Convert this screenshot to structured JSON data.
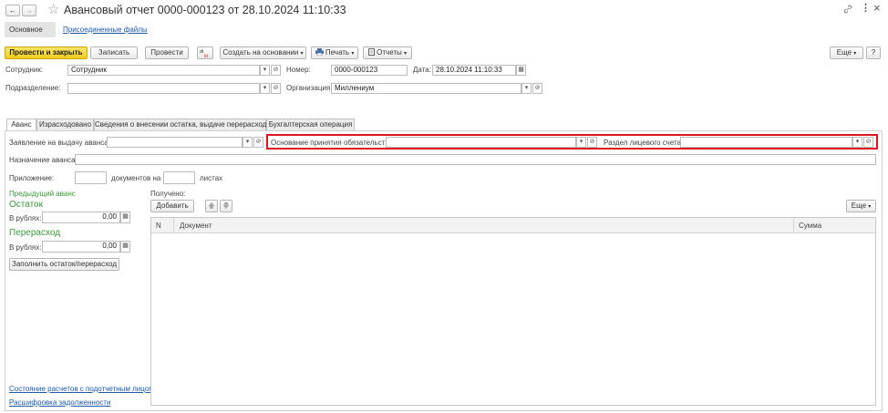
{
  "window": {
    "title": "Авансовый отчет 0000-000123 от 28.10.2024 11:10:33",
    "nav_back": "←",
    "nav_forward": "→",
    "star": "☆",
    "link_icon": "link-icon",
    "more_dots": "⋮",
    "close": "×"
  },
  "sections": {
    "main": "Основное",
    "attached_files": "Присоединенные файлы"
  },
  "toolbar": {
    "post_and_close": "Провести и закрыть",
    "save": "Записать",
    "post": "Провести",
    "create_based": "Создать на основании",
    "print": "Печать",
    "reports": "Отчеты",
    "more": "Еще",
    "help": "?"
  },
  "header": {
    "employee_label": "Сотрудник:",
    "employee_value": "Сотрудник",
    "number_label": "Номер:",
    "number_value": "0000-000123",
    "date_label": "Дата:",
    "date_value": "28.10.2024 11:10:33",
    "department_label": "Подразделение:",
    "department_value": "",
    "organization_label": "Организация:",
    "organization_value": "Миллениум"
  },
  "tabs": [
    {
      "label": "Аванс"
    },
    {
      "label": "Израсходовано"
    },
    {
      "label": "Сведения о внесении остатка, выдаче перерасхода"
    },
    {
      "label": "Бухгалтерская операция"
    }
  ],
  "advance": {
    "request_label": "Заявление на выдачу аванса:",
    "request_value": "",
    "basis_label": "Основание принятия обязательства:",
    "basis_value": "",
    "account_section_label": "Раздел лицевого счета:",
    "account_section_value": "",
    "purpose_label": "Назначение аванса:",
    "purpose_value": "",
    "attachment_label": "Приложение:",
    "documents_on_label": "документов на",
    "sheets_label": "листах",
    "previous_advance": "Предыдущий аванс",
    "remainder_title": "Остаток",
    "in_rubles_label": "В рублях:",
    "remainder_value": "0,00",
    "overspend_title": "Перерасход",
    "overspend_value": "0,00",
    "fill_button": "Заполнить остаток/перерасход",
    "link_settlements": "Состояние расчетов с подотчетным лицом",
    "link_debt": "Расшифровка задолженности"
  },
  "received": {
    "label": "Получено:",
    "add_button": "Добавить",
    "more": "Еще",
    "columns": [
      "N",
      "Документ",
      "Сумма"
    ],
    "rows": []
  },
  "colors": {
    "accent_yellow": "#f5d21f",
    "highlight_red": "#e0141e",
    "green_text": "#3a9a3a",
    "link_blue": "#1f5aa6"
  }
}
